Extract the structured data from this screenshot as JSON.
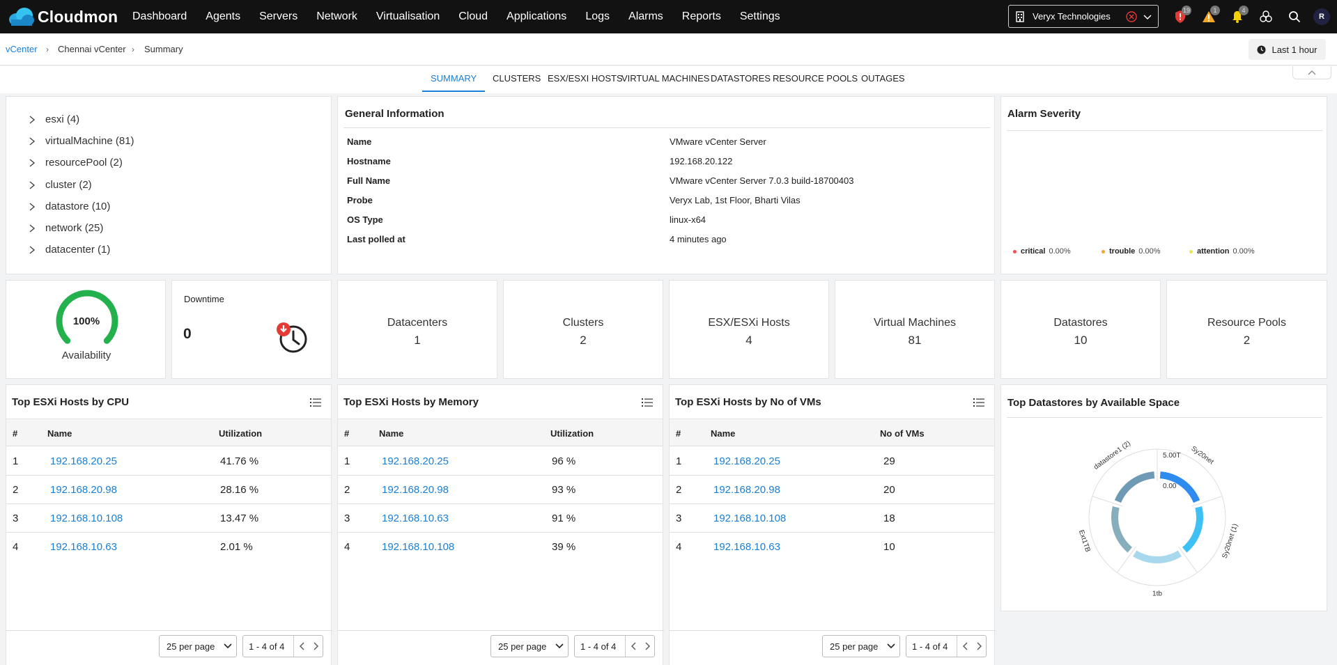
{
  "app": {
    "name": "Cloudmon"
  },
  "nav": [
    "Dashboard",
    "Agents",
    "Servers",
    "Network",
    "Virtualisation",
    "Cloud",
    "Applications",
    "Logs",
    "Alarms",
    "Reports",
    "Settings"
  ],
  "org_selector": {
    "value": "Veryx Technologies"
  },
  "top_icons": {
    "shield_badge": "19",
    "warning_badge": "1",
    "bell_badge": "4",
    "avatar_initial": "R"
  },
  "breadcrumb": [
    "vCenter",
    "Chennai vCenter",
    "Summary"
  ],
  "time_range": "Last 1 hour",
  "tabs": [
    "SUMMARY",
    "CLUSTERS",
    "ESX/ESXI HOSTS",
    "VIRTUAL MACHINES",
    "DATASTORES",
    "RESOURCE POOLS",
    "OUTAGES"
  ],
  "tree": [
    "esxi (4)",
    "virtualMachine (81)",
    "resourcePool (2)",
    "cluster (2)",
    "datastore (10)",
    "network (25)",
    "datacenter (1)"
  ],
  "general_info": {
    "title": "General Information",
    "rows": [
      {
        "label": "Name",
        "value": "VMware vCenter Server"
      },
      {
        "label": "Hostname",
        "value": "192.168.20.122"
      },
      {
        "label": "Full Name",
        "value": "VMware vCenter Server 7.0.3 build-18700403"
      },
      {
        "label": "Probe",
        "value": "Veryx Lab, 1st Floor, Bharti Vilas"
      },
      {
        "label": "OS Type",
        "value": "linux-x64"
      },
      {
        "label": "Last polled at",
        "value": "4 minutes ago"
      }
    ]
  },
  "alarm_severity": {
    "title": "Alarm Severity",
    "legend": [
      {
        "label": "critical",
        "value": "0.00%",
        "color": "#f05050"
      },
      {
        "label": "trouble",
        "value": "0.00%",
        "color": "#f5a623"
      },
      {
        "label": "attention",
        "value": "0.00%",
        "color": "#e8e84a"
      }
    ]
  },
  "availability": {
    "value": "100%",
    "label": "Availability",
    "fraction": 1.0
  },
  "downtime": {
    "label": "Downtime",
    "value": "0"
  },
  "stats": [
    {
      "label": "Datacenters",
      "value": "1"
    },
    {
      "label": "Clusters",
      "value": "2"
    },
    {
      "label": "ESX/ESXi Hosts",
      "value": "4"
    },
    {
      "label": "Virtual Machines",
      "value": "81"
    },
    {
      "label": "Datastores",
      "value": "10"
    },
    {
      "label": "Resource Pools",
      "value": "2"
    }
  ],
  "cpu_table": {
    "title": "Top ESXi Hosts by CPU",
    "headers": [
      "#",
      "Name",
      "Utilization"
    ],
    "rows": [
      [
        "1",
        "192.168.20.25",
        "41.76 %"
      ],
      [
        "2",
        "192.168.20.98",
        "28.16 %"
      ],
      [
        "3",
        "192.168.10.108",
        "13.47 %"
      ],
      [
        "4",
        "192.168.10.63",
        "2.01 %"
      ]
    ],
    "per_page": "25 per page",
    "page_info": "1 - 4 of 4"
  },
  "memory_table": {
    "title": "Top ESXi Hosts by Memory",
    "headers": [
      "#",
      "Name",
      "Utilization"
    ],
    "rows": [
      [
        "1",
        "192.168.20.25",
        "96 %"
      ],
      [
        "2",
        "192.168.20.98",
        "93 %"
      ],
      [
        "3",
        "192.168.10.63",
        "91 %"
      ],
      [
        "4",
        "192.168.10.108",
        "39 %"
      ]
    ],
    "per_page": "25 per page",
    "page_info": "1 - 4 of 4"
  },
  "vms_table": {
    "title": "Top ESXi Hosts by No of VMs",
    "headers": [
      "#",
      "Name",
      "No of VMs"
    ],
    "rows": [
      [
        "1",
        "192.168.20.25",
        "29"
      ],
      [
        "2",
        "192.168.20.98",
        "20"
      ],
      [
        "3",
        "192.168.10.108",
        "18"
      ],
      [
        "4",
        "192.168.10.63",
        "10"
      ]
    ],
    "per_page": "25 per page",
    "page_info": "1 - 4 of 4"
  },
  "datastores_chart": {
    "title": "Top Datastores by Available Space",
    "scale_max": "5.00T",
    "scale_min": "0.00",
    "segments": [
      {
        "label": "Sy20net",
        "color": "#2e8bf0"
      },
      {
        "label": "Sy20net (1)",
        "color": "#3ec0f5"
      },
      {
        "label": "1tb",
        "color": "#a7d8ee"
      },
      {
        "label": "Ext1TB",
        "color": "#86aebd"
      },
      {
        "label": "datastore1 (2)",
        "color": "#6f9ab6"
      }
    ]
  }
}
